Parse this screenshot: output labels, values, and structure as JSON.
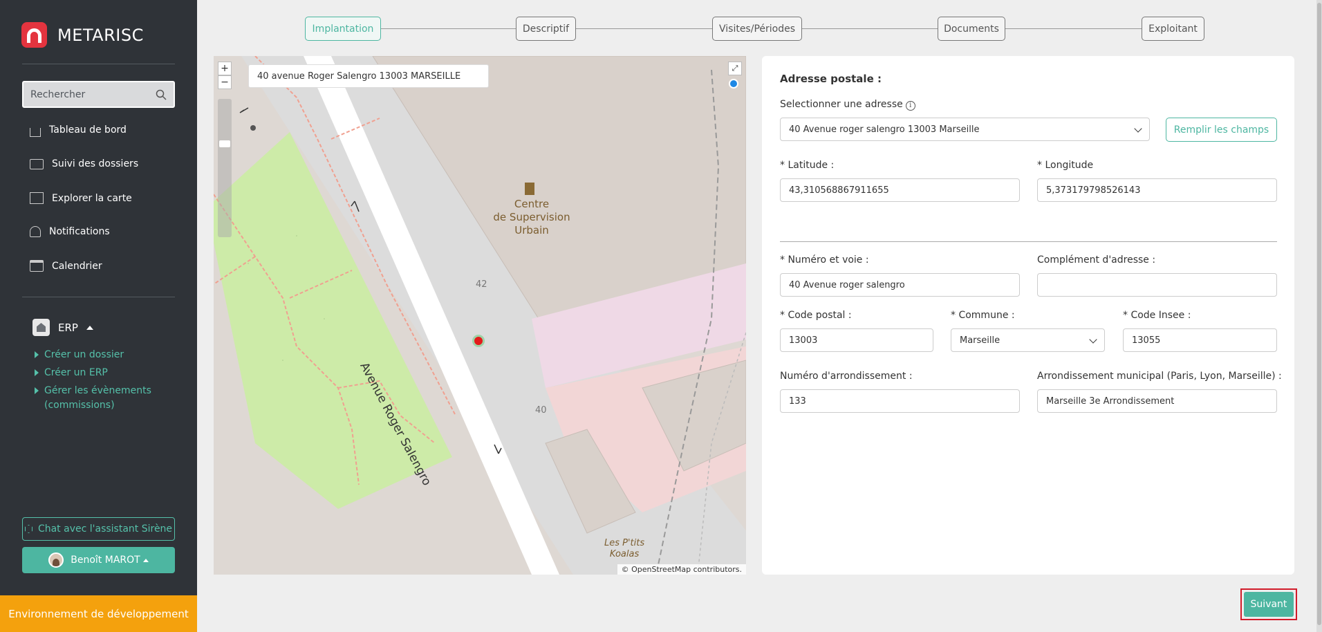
{
  "app": {
    "name": "METARISC"
  },
  "sidebar": {
    "search_placeholder": "Rechercher",
    "nav": [
      {
        "label": "Tableau de bord",
        "icon": "home-icon"
      },
      {
        "label": "Suivi des dossiers",
        "icon": "folder-icon"
      },
      {
        "label": "Explorer la carte",
        "icon": "map-icon"
      },
      {
        "label": "Notifications",
        "icon": "bell-icon"
      },
      {
        "label": "Calendrier",
        "icon": "calendar-icon"
      }
    ],
    "section": {
      "label": "ERP",
      "icon": "building-icon"
    },
    "sub_items": [
      {
        "label": "Créer un dossier"
      },
      {
        "label": "Créer un ERP"
      },
      {
        "label": "Gérer les évènements (commissions)"
      }
    ],
    "chat_label": "Chat avec l'assistant Sirène",
    "user_label": "Benoît MAROT",
    "env_label": "Environnement de développement"
  },
  "stepper": {
    "steps": [
      {
        "label": "Implantation",
        "active": true
      },
      {
        "label": "Descriptif",
        "active": false
      },
      {
        "label": "Visites/Périodes",
        "active": false
      },
      {
        "label": "Documents",
        "active": false
      },
      {
        "label": "Exploitant",
        "active": false
      }
    ]
  },
  "map": {
    "address_value": "40 avenue Roger Salengro 13003 MARSEILLE",
    "zoom_in": "+",
    "zoom_out": "−",
    "poi_label": "Centre de Supervision Urbain",
    "poi_line1": "Centre",
    "poi_line2": "de Supervision",
    "poi_line3": "Urbain",
    "street_label": "Avenue Roger Salengro",
    "house_number_1": "42",
    "house_number_2": "40",
    "poi2_line1": "Les P'tits",
    "poi2_line2": "Koalas",
    "attribution": "© OpenStreetMap contributors.",
    "fullscreen_icon": "⤢"
  },
  "form": {
    "title": "Adresse postale :",
    "select_address_label": "Selectionner une adresse",
    "select_address_value": "40 Avenue roger salengro 13003 Marseille",
    "fill_button": "Remplir les champs",
    "latitude_label": "* Latitude :",
    "latitude_value": "43,310568867911655",
    "longitude_label": "* Longitude",
    "longitude_value": "5,373179798526143",
    "street_label": "* Numéro et voie :",
    "street_value": "40 Avenue roger salengro",
    "complement_label": "Complément d'adresse :",
    "complement_value": "",
    "postal_label": "* Code postal :",
    "postal_value": "13003",
    "city_label": "* Commune :",
    "city_value": "Marseille",
    "insee_label": "* Code Insee :",
    "insee_value": "13055",
    "arr_num_label": "Numéro d'arrondissement :",
    "arr_num_value": "133",
    "arr_mun_label": "Arrondissement municipal (Paris, Lyon, Marseille) :",
    "arr_mun_value": "Marseille 3e Arrondissement"
  },
  "footer": {
    "next_label": "Suivant"
  },
  "colors": {
    "accent": "#4db6a1",
    "sidebar_bg": "#2f3338",
    "env_bar": "#f4a10d",
    "logo": "#e4343f"
  }
}
